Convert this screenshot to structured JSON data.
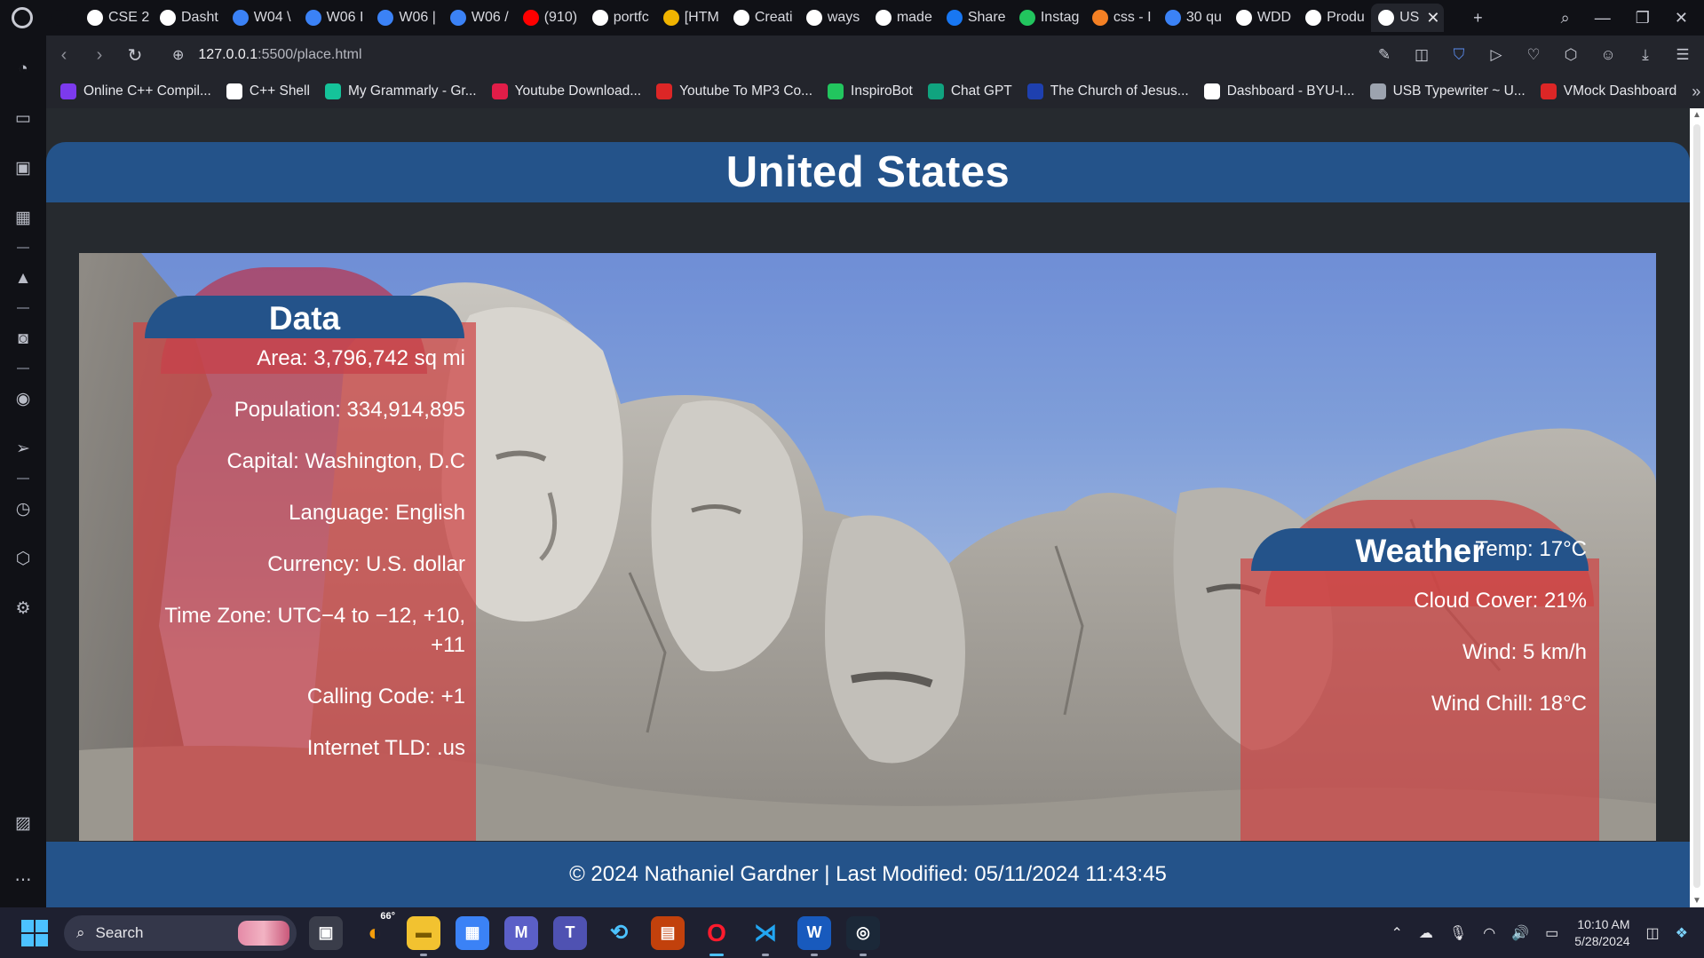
{
  "browser": {
    "tabs": [
      {
        "label": "",
        "icon": "gamepad-icon",
        "color": "#101116"
      },
      {
        "label": "CSE 2",
        "icon": "world-icon",
        "color": "#ffffff"
      },
      {
        "label": "Dasht",
        "icon": "byu-icon",
        "color": "#ffffff"
      },
      {
        "label": "W04 \\",
        "icon": "chart-icon",
        "color": "#3b82f6"
      },
      {
        "label": "W06 I",
        "icon": "chart-icon",
        "color": "#3b82f6"
      },
      {
        "label": "W06 |",
        "icon": "chart-icon",
        "color": "#3b82f6"
      },
      {
        "label": "W06 /",
        "icon": "chart-icon",
        "color": "#3b82f6"
      },
      {
        "label": "(910)",
        "icon": "youtube-icon",
        "color": "#ff0000"
      },
      {
        "label": "portfc",
        "icon": "google-icon",
        "color": "#ffffff"
      },
      {
        "label": "[HTM",
        "icon": "lock-icon",
        "color": "#f0b400"
      },
      {
        "label": "Creati",
        "icon": "world-icon",
        "color": "#ffffff"
      },
      {
        "label": "ways",
        "icon": "google-icon",
        "color": "#ffffff"
      },
      {
        "label": "made",
        "icon": "google-icon",
        "color": "#ffffff"
      },
      {
        "label": "Share",
        "icon": "facebook-icon",
        "color": "#1877f2"
      },
      {
        "label": "Instag",
        "icon": "replit-icon",
        "color": "#22c55e"
      },
      {
        "label": "css - I",
        "icon": "stack-icon",
        "color": "#f48024"
      },
      {
        "label": "30 qu",
        "icon": "quiz-icon",
        "color": "#3b82f6"
      },
      {
        "label": "WDD",
        "icon": "world-icon",
        "color": "#ffffff"
      },
      {
        "label": "Produ",
        "icon": "world-icon",
        "color": "#ffffff"
      },
      {
        "label": "US",
        "icon": "world-icon",
        "color": "#ffffff",
        "active": true
      }
    ],
    "url_host": "127.0.0.1",
    "url_path": ":5500/place.html",
    "bookmarks": [
      {
        "label": "Online C++ Compil...",
        "color": "#7c3aed"
      },
      {
        "label": "C++ Shell",
        "color": "#ffffff"
      },
      {
        "label": "My Grammarly - Gr...",
        "color": "#15c39a"
      },
      {
        "label": "Youtube Download...",
        "color": "#e11d48"
      },
      {
        "label": "Youtube To MP3 Co...",
        "color": "#dc2626"
      },
      {
        "label": "InspiroBot",
        "color": "#22c55e"
      },
      {
        "label": "Chat GPT",
        "color": "#10a37f"
      },
      {
        "label": "The Church of Jesus...",
        "color": "#1e40af"
      },
      {
        "label": "Dashboard - BYU-I...",
        "color": "#ffffff"
      },
      {
        "label": "USB Typewriter ~ U...",
        "color": "#9ca3af"
      },
      {
        "label": "VMock Dashboard",
        "color": "#dc2626"
      }
    ]
  },
  "page": {
    "title": "United States",
    "data_panel": {
      "heading": "Data",
      "items": [
        "Area: 3,796,742 sq mi",
        "Population: 334,914,895",
        "Capital: Washington, D.C",
        "Language: English",
        "Currency: U.S. dollar",
        "Time Zone: UTC−4 to −12, +10,",
        "+11",
        "Calling Code: +1",
        "Internet TLD: .us"
      ]
    },
    "weather_panel": {
      "heading": "Weather",
      "items": [
        "Temp: 17°C",
        "Cloud Cover: 21%",
        "Wind: 5 km/h",
        "Wind Chill: 18°C"
      ]
    },
    "footer": "© 2024 Nathaniel Gardner | Last Modified: 05/11/2024 11:43:45",
    "colors": {
      "header_blue": "#24538a",
      "panel_red": "rgba(207,68,68,0.72)",
      "page_bg": "#262a2f"
    }
  },
  "taskbar": {
    "search_label": "Search",
    "weather_badge": "66°",
    "time": "10:10 AM",
    "date": "5/28/2024"
  }
}
